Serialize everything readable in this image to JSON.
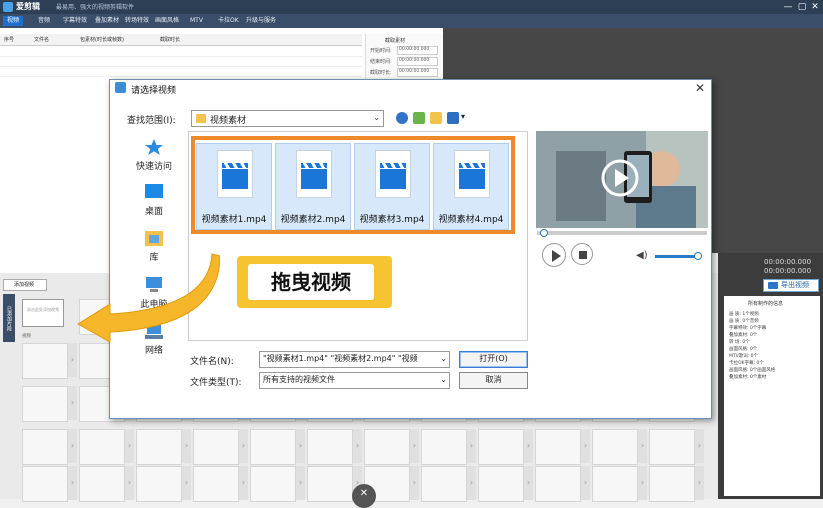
{
  "app": {
    "name": "爱剪辑",
    "subtitle": "最易用、强大的视频剪辑软件",
    "window_controls": [
      "—",
      "▢",
      "✕"
    ]
  },
  "menu": [
    "视频",
    "音频",
    "字幕特效",
    "叠加素材",
    "转场特效",
    "画面风格",
    "MTV",
    "卡拉OK",
    "升级与服务"
  ],
  "list_columns": [
    "序号",
    "文件名",
    "包素材(时长或帧数)",
    "截取时长"
  ],
  "clip_panel": {
    "title": "截取素材",
    "fields": [
      {
        "label": "开始时间:",
        "value": "00:00:00.000"
      },
      {
        "label": "结束时间:",
        "value": "00:00:00.000"
      },
      {
        "label": "截取时长:",
        "value": "00:00:00.000"
      }
    ]
  },
  "editor": {
    "add_video_label": "添加视频",
    "side_tab_label": "已添加片段",
    "first_thumb_text": "双击此处添加视频",
    "first_thumb_caption": "视频",
    "timecodes": [
      "00:00:00.000",
      "00:00:00.000"
    ],
    "export_label": "导出视频",
    "info_title": "所有制作的信息",
    "info_rows": [
      {
        "k": "画    质:",
        "v": "1个视频"
      },
      {
        "k": "画    质:",
        "v": "0个音频"
      },
      {
        "k": "字幕特效:",
        "v": "0个字幕"
      },
      {
        "k": "叠加素材:",
        "v": "0个"
      },
      {
        "k": "转    场:",
        "v": "0个"
      },
      {
        "k": "画面风格:",
        "v": "0个"
      },
      {
        "k": "MTV歌词:",
        "v": "0个"
      },
      {
        "k": "卡拉OK字幕:",
        "v": "0个"
      },
      {
        "k": "画面风格:",
        "v": "0个画面风格"
      },
      {
        "k": "叠加素材:",
        "v": "0个素材"
      }
    ]
  },
  "dialog": {
    "title": "请选择视频",
    "close": "✕",
    "lookin_label": "查找范围(I):",
    "lookin_value": "视频素材",
    "places": [
      "快速访问",
      "桌面",
      "库",
      "此电脑",
      "网络"
    ],
    "files": [
      "视频素材1.mp4",
      "视频素材2.mp4",
      "视频素材3.mp4",
      "视频素材4.mp4"
    ],
    "filename_label": "文件名(N):",
    "filename_value": "\"视频素材1.mp4\" \"视频素材2.mp4\" \"视频",
    "filetype_label": "文件类型(T):",
    "filetype_value": "所有支持的视频文件",
    "open_button": "打开(O)",
    "cancel_button": "取消"
  },
  "callout": {
    "text": "拖曳视频"
  },
  "colors": {
    "accent": "#1f6fc9",
    "orange": "#ef8a2a",
    "callout_yellow": "#f6c431",
    "file_blue": "#1a77d8"
  }
}
